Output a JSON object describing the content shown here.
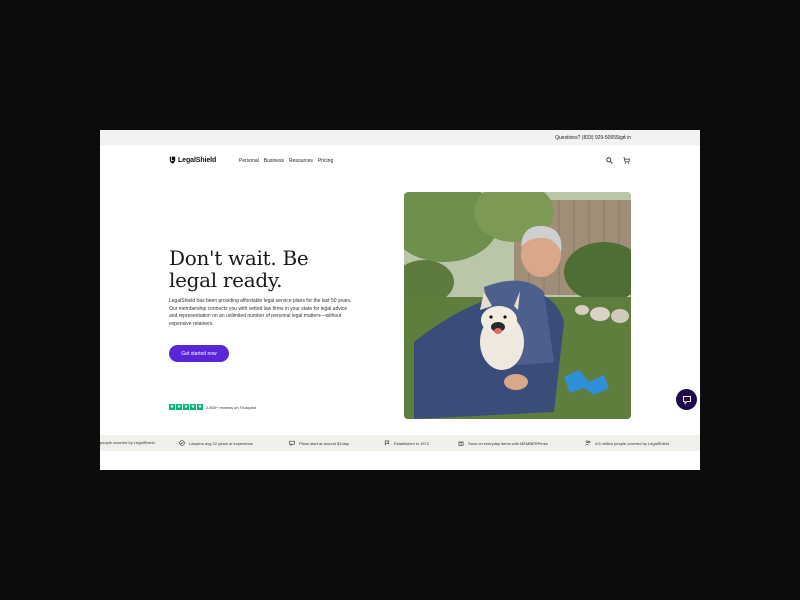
{
  "utility": {
    "phone": "Questions? (833) 929-5065",
    "separator": "|",
    "signin": "Sign in"
  },
  "brand": {
    "name": "LegalShield"
  },
  "nav": {
    "items": [
      "Personal",
      "Business",
      "Resources",
      "Pricing"
    ]
  },
  "hero": {
    "headline_1": "Don't wait. Be",
    "headline_2": "legal ready.",
    "body": "LegalShield has been providing affordable legal service plans for the last 50 years. Our membership connects you with vetted law firms in your state for legal advice and representation on an unlimited number of personal legal matters—without expensive retainers.",
    "cta": "Get started now",
    "rating_text": "2,800+ reviews on Trustpilot"
  },
  "ticker": {
    "items": [
      {
        "icon": "people-icon",
        "text": "people covered by LegalShield"
      },
      {
        "icon": "check-circle-icon",
        "text": "Lawyers avg 22 years of experience"
      },
      {
        "icon": "chat-icon",
        "text": "Plans start at around $1/day"
      },
      {
        "icon": "flag-icon",
        "text": "Established in 1972"
      },
      {
        "icon": "gift-icon",
        "text": "Save on everyday items with MEMBERPerks"
      },
      {
        "icon": "people-icon",
        "text": "4.5 million people covered by LegalShield"
      }
    ]
  },
  "colors": {
    "accent": "#5b25d9",
    "chat": "#1f0a4a",
    "trustpilot": "#00b67a",
    "ticker_bg": "#f0efe9"
  }
}
